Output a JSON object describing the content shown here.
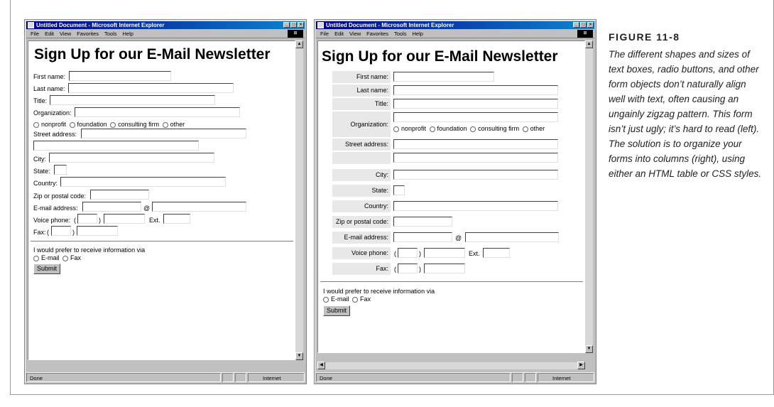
{
  "window": {
    "title": "Untitled Document - Microsoft Internet Explorer",
    "menu": [
      "File",
      "Edit",
      "View",
      "Favorites",
      "Tools",
      "Help"
    ],
    "status": "Done",
    "zone": "Internet"
  },
  "form": {
    "heading": "Sign Up for our E-Mail Newsletter",
    "first_name": "First name:",
    "last_name": "Last name:",
    "title": "Title:",
    "organization": "Organization:",
    "org_options": [
      "nonprofit",
      "foundation",
      "consulting firm",
      "other"
    ],
    "street": "Street address:",
    "city": "City:",
    "state": "State:",
    "country": "Country:",
    "zip": "Zip or postal code:",
    "email": "E-mail address:",
    "at": "@",
    "voice": "Voice phone:",
    "paren_open": "(",
    "paren_close": ")",
    "ext": "Ext.",
    "fax": "Fax:",
    "prefer": "I would prefer to receive information via",
    "pref_options": [
      "E-mail",
      "Fax"
    ],
    "submit": "Submit"
  },
  "caption": {
    "label": "FIGURE 11-8",
    "text": "The different shapes and sizes of text boxes, radio buttons, and other form objects don’t naturally align well with text, often causing an ungainly zigzag pattern. This form isn’t just ugly; it’s hard to read (left). The solution is to organize your forms into columns (right), using either an HTML table or CSS styles."
  }
}
